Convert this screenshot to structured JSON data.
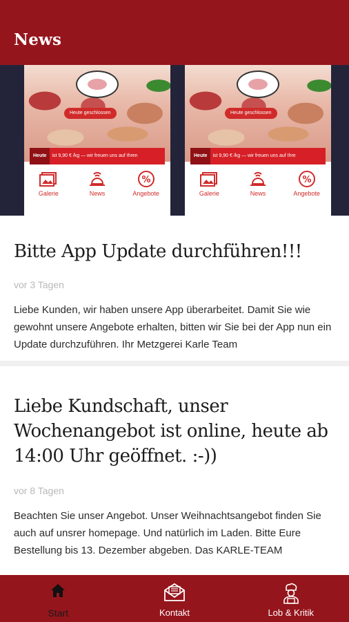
{
  "header": {
    "title": "News"
  },
  "banner": {
    "screens": [
      {
        "status_pill": "Heute geschlossen",
        "ticker_tag": "Heute",
        "ticker_text": "ist 9,90 € /kg — wir freuen uns auf Ihren",
        "icons": [
          {
            "label": "Galerie"
          },
          {
            "label": "News"
          },
          {
            "label": "Angebote"
          }
        ]
      },
      {
        "status_pill": "Heute geschlossen",
        "ticker_tag": "Heute",
        "ticker_text": "ist 9,90 € /kg — wir freuen uns auf Ihre",
        "icons": [
          {
            "label": "Galerie"
          },
          {
            "label": "News"
          },
          {
            "label": "Angebote"
          }
        ]
      }
    ]
  },
  "news": [
    {
      "title": "Bitte App Update durchführen!!!",
      "date": "vor 3 Tagen",
      "body": "Liebe Kunden, wir haben unsere App überarbeitet. Damit Sie wie gewohnt unsere Angebote erhalten, bitten wir Sie bei der App nun ein Update durchzuführen. Ihr Metzgerei Karle Team"
    },
    {
      "title": "Liebe Kundschaft, unser Wochenangebot ist online, heute ab 14:00 Uhr geöffnet. :-))",
      "date": "vor 8 Tagen",
      "body": "Beachten Sie unser Angebot. Unser Weihnachtsangebot finden Sie auch auf unsrer homepage. Und natürlich im Laden. Bitte Eure Bestellung bis 13. Dezember abgeben. Das KARLE-TEAM"
    }
  ],
  "tabbar": {
    "items": [
      {
        "label": "Start",
        "icon": "home-icon",
        "active": true
      },
      {
        "label": "Kontakt",
        "icon": "envelope-icon",
        "active": false
      },
      {
        "label": "Lob & Kritik",
        "icon": "chef-icon",
        "active": false
      }
    ]
  },
  "colors": {
    "brand": "#95151c",
    "accent": "#d02a2a",
    "banner_bg": "#23243a"
  }
}
